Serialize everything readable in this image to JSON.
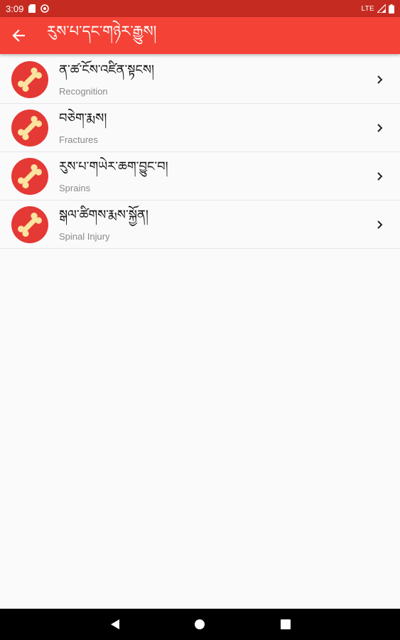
{
  "status_bar": {
    "time": "3:09",
    "network": "LTE",
    "icons": [
      "sd-card-icon",
      "sync-icon",
      "signal-icon",
      "battery-icon"
    ]
  },
  "app_bar": {
    "title": "རུས་པ་དང་གཉེར་རྒྱུས།",
    "back_icon": "arrow-left-icon",
    "color": "#f44336"
  },
  "list": {
    "items": [
      {
        "title": "ན་ཚ་ངོས་འཛིན་སྟངས།",
        "subtitle": "Recognition",
        "icon": "bone-icon"
      },
      {
        "title": "བཅེག་རྨས།",
        "subtitle": "Fractures",
        "icon": "bone-icon"
      },
      {
        "title": "རུས་པ་གཡེར་ཆག་བྱུང་བ།",
        "subtitle": "Sprains",
        "icon": "bone-icon"
      },
      {
        "title": "སྒལ་ཚིགས་རྨས་སྐྱོན།",
        "subtitle": "Spinal Injury",
        "icon": "bone-icon"
      }
    ]
  },
  "colors": {
    "status_bar": "#c62b21",
    "app_bar": "#f44336",
    "avatar_red": "#e53935",
    "bone": "#fbe3a0"
  },
  "nav_bar": {
    "buttons": [
      "back-triangle-icon",
      "home-circle-icon",
      "recents-square-icon"
    ]
  }
}
